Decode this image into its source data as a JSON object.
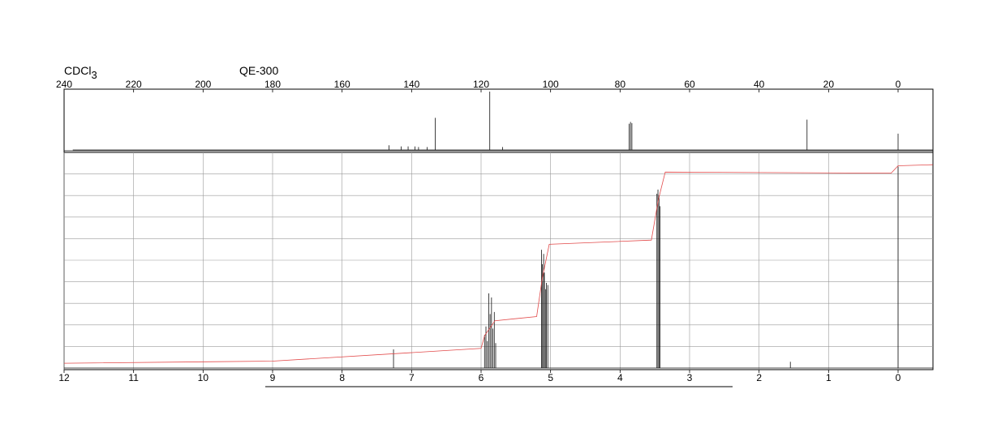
{
  "header": {
    "solvent_base": "CDCl",
    "solvent_sub": "3",
    "instrument": "QE-300"
  },
  "colors": {
    "spectrum": "#111111",
    "integral": "#e24a4a",
    "grid": "#9a9a9a"
  },
  "chart_data": [
    {
      "type": "line",
      "nucleus": "13C",
      "x_axis_ticks": [
        "240",
        "220",
        "200",
        "180",
        "160",
        "140",
        "120",
        "100",
        "80",
        "60",
        "40",
        "20",
        "0"
      ],
      "xlim": [
        240,
        -10
      ],
      "x_reversed": true,
      "peaks": [
        {
          "x": 146.5,
          "y": 0.08
        },
        {
          "x": 143.0,
          "y": 0.06
        },
        {
          "x": 141.0,
          "y": 0.06
        },
        {
          "x": 139.0,
          "y": 0.06
        },
        {
          "x": 138.0,
          "y": 0.05
        },
        {
          "x": 135.5,
          "y": 0.05
        },
        {
          "x": 133.2,
          "y": 0.55
        },
        {
          "x": 117.5,
          "y": 1.0
        },
        {
          "x": 113.8,
          "y": 0.05
        },
        {
          "x": 77.4,
          "y": 0.45
        },
        {
          "x": 77.0,
          "y": 0.48
        },
        {
          "x": 76.6,
          "y": 0.46
        },
        {
          "x": 26.2,
          "y": 0.52
        },
        {
          "x": 0.0,
          "y": 0.28
        }
      ]
    },
    {
      "type": "line",
      "nucleus": "1H",
      "x_axis_ticks": [
        "12",
        "11",
        "10",
        "9",
        "8",
        "7",
        "6",
        "5",
        "4",
        "3",
        "2",
        "1",
        "0"
      ],
      "xlim": [
        12,
        -0.5
      ],
      "x_reversed": true,
      "grid": true,
      "peaks": [
        {
          "x": 7.26,
          "y": 0.09
        },
        {
          "x": 5.95,
          "y": 0.16
        },
        {
          "x": 5.93,
          "y": 0.2
        },
        {
          "x": 5.91,
          "y": 0.13
        },
        {
          "x": 5.89,
          "y": 0.36
        },
        {
          "x": 5.87,
          "y": 0.26
        },
        {
          "x": 5.85,
          "y": 0.34
        },
        {
          "x": 5.83,
          "y": 0.19
        },
        {
          "x": 5.81,
          "y": 0.27
        },
        {
          "x": 5.79,
          "y": 0.12
        },
        {
          "x": 5.13,
          "y": 0.57
        },
        {
          "x": 5.12,
          "y": 0.5
        },
        {
          "x": 5.1,
          "y": 0.55
        },
        {
          "x": 5.09,
          "y": 0.46
        },
        {
          "x": 5.07,
          "y": 0.38
        },
        {
          "x": 5.06,
          "y": 0.41
        },
        {
          "x": 5.04,
          "y": 0.4
        },
        {
          "x": 3.47,
          "y": 0.84
        },
        {
          "x": 3.455,
          "y": 0.86
        },
        {
          "x": 3.44,
          "y": 0.83
        },
        {
          "x": 3.425,
          "y": 0.78
        },
        {
          "x": 1.55,
          "y": 0.03
        },
        {
          "x": 0.0,
          "y": 0.97
        }
      ],
      "integral": [
        {
          "x": 12.0,
          "y": 0.03
        },
        {
          "x": 9.0,
          "y": 0.04
        },
        {
          "x": 6.0,
          "y": 0.1
        },
        {
          "x": 5.95,
          "y": 0.16
        },
        {
          "x": 5.8,
          "y": 0.23
        },
        {
          "x": 5.2,
          "y": 0.25
        },
        {
          "x": 5.12,
          "y": 0.43
        },
        {
          "x": 5.02,
          "y": 0.59
        },
        {
          "x": 3.55,
          "y": 0.61
        },
        {
          "x": 3.45,
          "y": 0.8
        },
        {
          "x": 3.35,
          "y": 0.93
        },
        {
          "x": 0.1,
          "y": 0.925
        },
        {
          "x": 0.0,
          "y": 0.96
        },
        {
          "x": -0.5,
          "y": 0.965
        }
      ]
    }
  ]
}
